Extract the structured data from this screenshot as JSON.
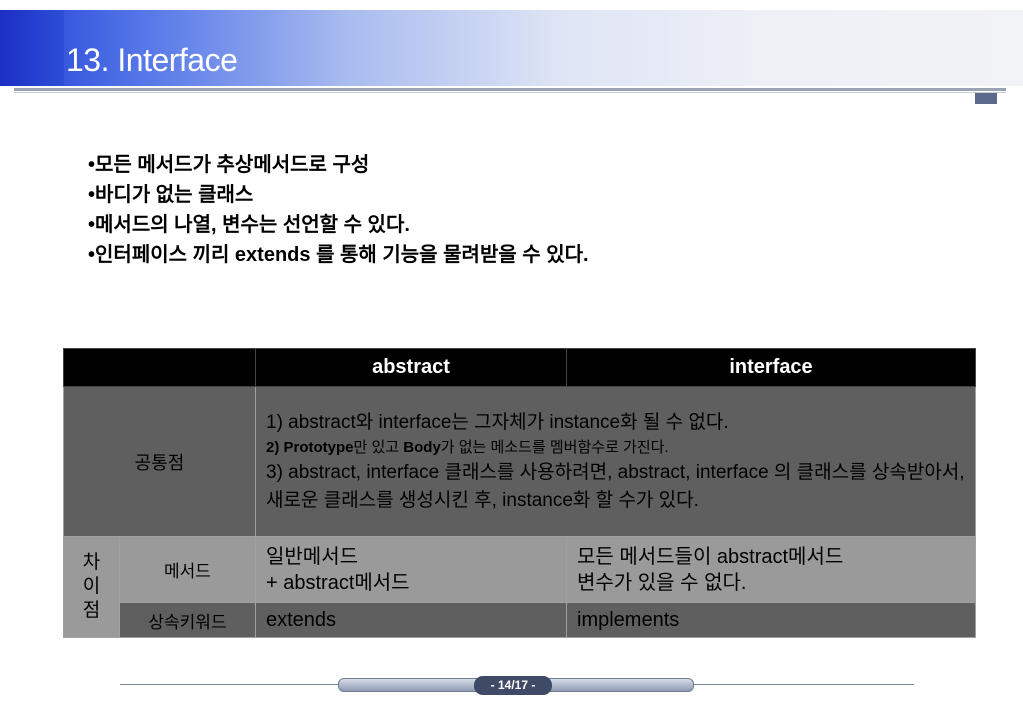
{
  "slide": {
    "title": "13. Interface",
    "bullets": [
      "모든 메서드가 추상메서드로 구성",
      "바디가 없는 클래스",
      "메서드의 나열, 변수는 선언할 수 있다.",
      "인터페이스 끼리 extends 를 통해 기능을 물려받을 수 있다."
    ],
    "page_number": "- 14/17 -"
  },
  "table": {
    "headers": [
      "",
      "abstract",
      "interface"
    ],
    "common": {
      "label": "공통점",
      "line1": "1) abstract와 interface는 그자체가 instance화 될 수 없다.",
      "line2_prefix": "2) ",
      "line2_bold1": "Prototype",
      "line2_mid": "만 있고 ",
      "line2_bold2": "Body",
      "line2_suffix": "가 없는 메소드를 멤버함수로 가진다.",
      "line3": "3) abstract, interface 클래스를 사용하려면, abstract, interface 의 클래스를 상속받아서, 새로운 클래스를 생성시킨 후, instance화 할 수가 있다."
    },
    "difference": {
      "label": "차이점",
      "rows": [
        {
          "label": "메서드",
          "abstract_line1": "일반메서드",
          "abstract_line2": "+ abstract메서드",
          "interface_line1": "모든 메서드들이 abstract메서드",
          "interface_line2": "변수가 있을 수 없다."
        },
        {
          "label": "상속키워드",
          "abstract": "extends",
          "interface": "implements"
        }
      ]
    }
  }
}
